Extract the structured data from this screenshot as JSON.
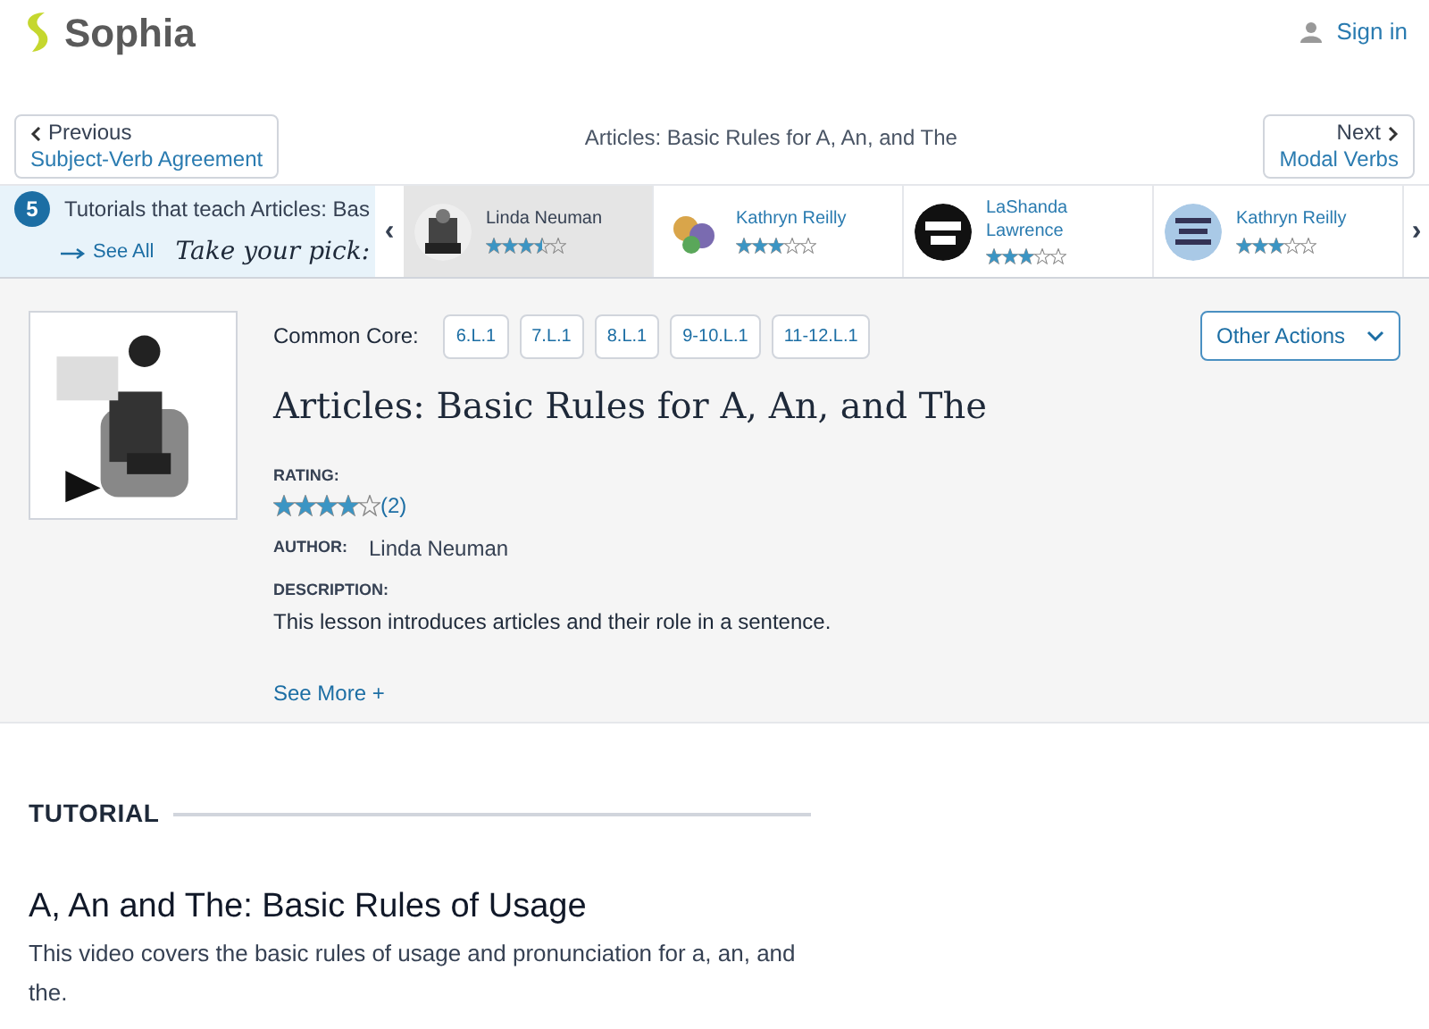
{
  "header": {
    "logo": "Sophia",
    "sign_in": "Sign in"
  },
  "nav": {
    "previous": {
      "label": "Previous",
      "title": "Subject-Verb Agreement"
    },
    "current": "Articles: Basic Rules for A, An, and The",
    "next": {
      "label": "Next",
      "title": "Modal Verbs"
    }
  },
  "tutorials_strip": {
    "count": "5",
    "text": "Tutorials that teach Articles: Bas",
    "see_all": "See All",
    "tagline": "Take your pick:",
    "prev_arrow": "‹",
    "next_arrow": "›",
    "items": [
      {
        "author": "Linda Neuman",
        "stars": 3.5,
        "selected": true
      },
      {
        "author": "Kathryn Reilly",
        "stars": 3,
        "selected": false
      },
      {
        "author": "LaShanda Lawrence",
        "stars": 3,
        "selected": false
      },
      {
        "author": "Kathryn Reilly",
        "stars": 3,
        "selected": false
      }
    ]
  },
  "lesson": {
    "common_core_label": "Common Core:",
    "standards": [
      "6.L.1",
      "7.L.1",
      "8.L.1",
      "9-10.L.1",
      "11-12.L.1"
    ],
    "other_actions": "Other Actions",
    "title": "Articles: Basic Rules for A, An, and The",
    "rating_label": "RATING:",
    "stars": 4,
    "rating_count": "(2)",
    "author_label": "AUTHOR:",
    "author": "Linda Neuman",
    "description_label": "DESCRIPTION:",
    "description": "This lesson introduces articles and their role in a sentence.",
    "see_more": "See More +"
  },
  "tutorial": {
    "heading": "TUTORIAL",
    "title": "A, An and The: Basic Rules of Usage",
    "description": "This video covers the basic rules of usage and pronunciation for a, an, and the."
  }
}
